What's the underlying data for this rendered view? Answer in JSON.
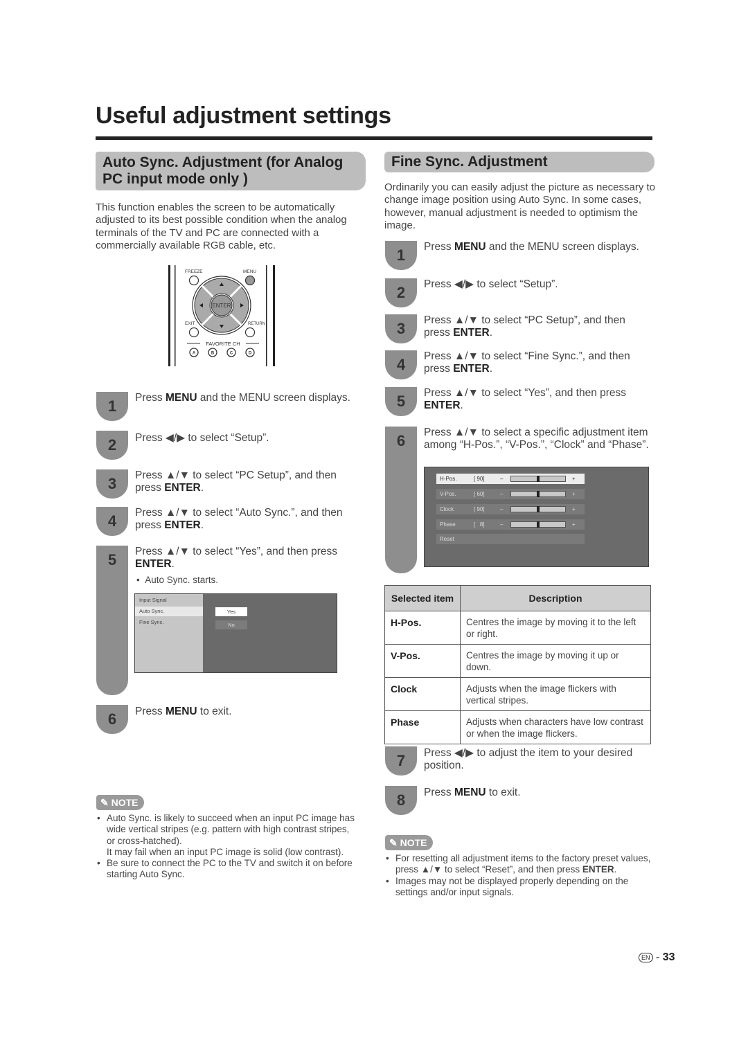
{
  "page": {
    "title": "Useful adjustment settings",
    "page_number": "33",
    "language_badge": "EN",
    "page_separator": "-"
  },
  "left": {
    "heading": "Auto Sync. Adjustment (for Analog PC input mode only )",
    "intro": "This function enables the screen to be automatically adjusted to its best possible condition when the analog terminals of the TV and PC are connected with a commercially available RGB cable, etc.",
    "remote": {
      "freeze": "FREEZE",
      "menu": "MENU",
      "enter": "ENTER",
      "exit": "EXIT",
      "return": "RETURN",
      "favorite": "FAVORITE CH",
      "buttons": [
        "A",
        "B",
        "C",
        "D"
      ]
    },
    "steps": [
      {
        "num": "1",
        "pre": "Press ",
        "bold": "MENU",
        "post": " and the MENU screen displays.",
        "pre2": "",
        "bold2": "",
        "post2": ""
      },
      {
        "num": "2",
        "pre": "Press ◀/▶ to select “Setup”.",
        "bold": "",
        "post": "",
        "pre2": "",
        "bold2": "",
        "post2": ""
      },
      {
        "num": "3",
        "pre": "Press ▲/▼ to select “PC Setup”, and then press ",
        "bold": "ENTER",
        "post": ".",
        "pre2": "",
        "bold2": "",
        "post2": ""
      },
      {
        "num": "4",
        "pre": "Press ▲/▼ to select “Auto Sync.”, and then press ",
        "bold": "ENTER",
        "post": ".",
        "pre2": "",
        "bold2": "",
        "post2": ""
      },
      {
        "num": "5",
        "pre": "Press ▲/▼ to select “Yes”, and then press ",
        "bold": "ENTER",
        "post": ".",
        "sub": "Auto Sync. starts."
      },
      {
        "num": "6",
        "pre": "Press ",
        "bold": "MENU",
        "post": " to exit."
      }
    ],
    "osd": {
      "items": [
        "Input Signal",
        "Auto Sync.",
        "Fine Sync."
      ],
      "options": [
        "Yes",
        "No"
      ],
      "selected_item": "Auto Sync.",
      "selected_option": "Yes"
    },
    "note_label": "NOTE",
    "notes": [
      "Auto Sync. is likely to succeed when an input PC image has wide vertical stripes (e.g. pattern with high contrast stripes, or cross-hatched).",
      "It may fail when an input PC image is solid (low contrast).",
      "Be sure to connect the PC to the TV and switch it on before starting Auto Sync."
    ]
  },
  "right": {
    "heading": "Fine Sync. Adjustment",
    "intro": "Ordinarily you can easily adjust the picture as necessary to change image position using Auto Sync. In some cases, however, manual adjustment is needed to optimism the image.",
    "steps": [
      {
        "num": "1",
        "pre": "Press ",
        "bold": "MENU",
        "post": " and the MENU screen displays."
      },
      {
        "num": "2",
        "pre": "Press ◀/▶ to select “Setup”.",
        "bold": "",
        "post": ""
      },
      {
        "num": "3",
        "pre": "Press ▲/▼ to select “PC Setup”, and then press ",
        "bold": "ENTER",
        "post": "."
      },
      {
        "num": "4",
        "pre": "Press ▲/▼ to select “Fine Sync.”, and then press ",
        "bold": "ENTER",
        "post": "."
      },
      {
        "num": "5",
        "pre": "Press ▲/▼ to select “Yes”, and then press ",
        "bold": "ENTER",
        "post": "."
      },
      {
        "num": "6",
        "pre": "Press ▲/▼ to select a specific adjustment item among “H-Pos.”, “V-Pos.”, “Clock” and “Phase”.",
        "bold": "",
        "post": ""
      },
      {
        "num": "7",
        "pre": "Press ◀/▶ to adjust the item to your desired position.",
        "bold": "",
        "post": ""
      },
      {
        "num": "8",
        "pre": "Press ",
        "bold": "MENU",
        "post": " to exit."
      }
    ],
    "osd": {
      "rows": [
        {
          "label": "H-Pos.",
          "value": "[ 90]",
          "minus": "–",
          "plus": "+",
          "level": 0.5,
          "selected": true
        },
        {
          "label": "V-Pos.",
          "value": "[ 60]",
          "minus": "–",
          "plus": "+",
          "level": 0.5,
          "selected": false
        },
        {
          "label": "Clock",
          "value": "[ 90]",
          "minus": "–",
          "plus": "+",
          "level": 0.5,
          "selected": false
        },
        {
          "label": "Phase",
          "value": "[   8]",
          "minus": "–",
          "plus": "+",
          "level": 0.5,
          "selected": false
        }
      ],
      "reset": "Reset"
    },
    "table": {
      "headers": [
        "Selected item",
        "Description"
      ],
      "rows": [
        {
          "item": "H-Pos.",
          "desc": "Centres the image by moving it to the left or right."
        },
        {
          "item": "V-Pos.",
          "desc": "Centres the image by moving it up or down."
        },
        {
          "item": "Clock",
          "desc": "Adjusts when the image flickers with vertical stripes."
        },
        {
          "item": "Phase",
          "desc": "Adjusts when characters have low contrast or when the image flickers."
        }
      ]
    },
    "note_label": "NOTE",
    "notes": [
      {
        "pre": "For resetting all adjustment items to the factory preset values, press ▲/▼ to select “Reset”, and then press ",
        "bold": "ENTER",
        "post": "."
      },
      {
        "pre": "Images may not be displayed properly depending on the settings and/or input signals.",
        "bold": "",
        "post": ""
      }
    ]
  }
}
